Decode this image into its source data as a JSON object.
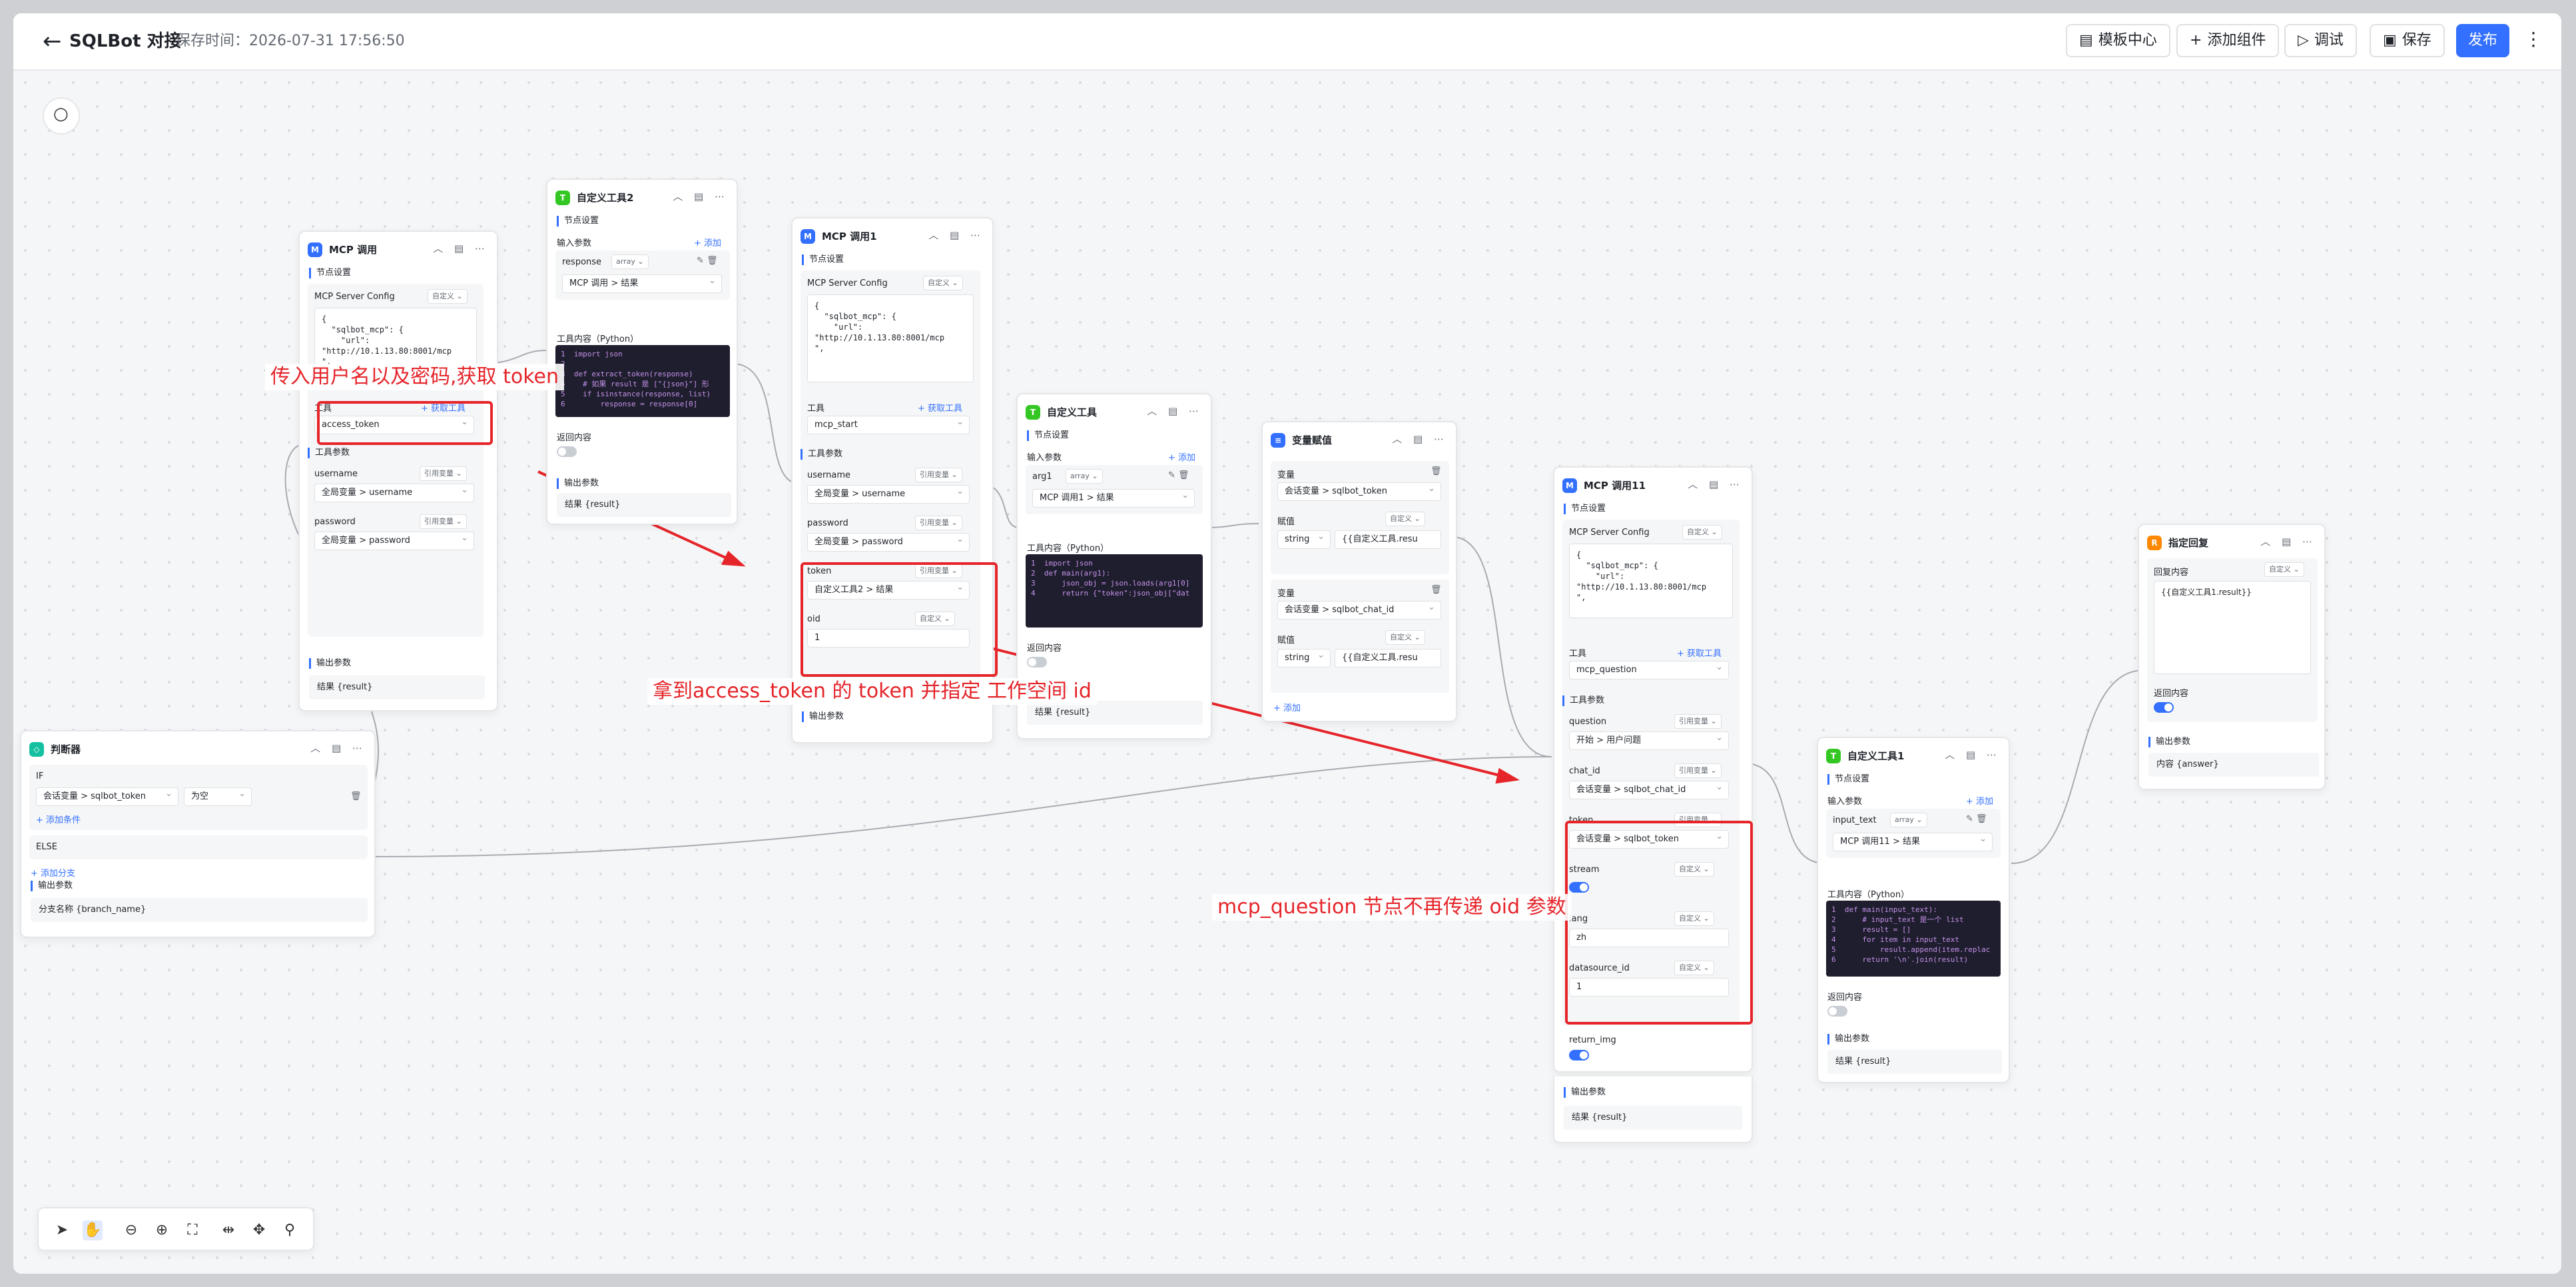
{
  "header": {
    "back": "←",
    "title": "SQLBot 对接",
    "save_time": "保存时间：2026-07-31 17:56:50",
    "template_center": "模板中心",
    "add_component": "添加组件",
    "debug": "调试",
    "save": "保存",
    "publish": "发布",
    "more": "⋮"
  },
  "icons": {
    "back": "arrow-left-icon",
    "search": "search-icon",
    "template": "file-icon",
    "add": "plus-icon",
    "debug": "play-icon",
    "save": "save-icon"
  },
  "colors": {
    "accent": "#3370ff",
    "annotation": "#e5252a",
    "node_mcp": "#3370ff",
    "node_tool": "#34c724",
    "node_reply": "#ff8800"
  },
  "common": {
    "node_settings": "节点设置",
    "input_params": "输入参数",
    "tool_params": "工具参数",
    "output_params": "输出参数",
    "tool_content": "工具内容（Python）",
    "return_content": "返回内容",
    "add": "+ 添加",
    "get_tools": "+ 获取工具",
    "tool": "工具",
    "mcp_server_config": "MCP Server Config",
    "custom": "自定义",
    "ref_var": "引用变量",
    "result": "结果 {result}",
    "array": "array"
  },
  "mcp1": {
    "title": "MCP 调用",
    "config": "{\n  \"sqlbot_mcp\": {\n    \"url\":\n\"http://10.1.13.80:8001/mcp\n\",",
    "tool": "access_token",
    "p1": "username",
    "p1v": "全局变量 > username",
    "p2": "password",
    "p2v": "全局变量 > password"
  },
  "tool2": {
    "title": "自定义工具2",
    "param": "response",
    "paramv": "MCP 调用 > 结果",
    "code": "1  import json\n2\n3  def extract_token(response)\n4    # 如果 result 是 [\"{json}\"] 形\n5    if isinstance(response, list)\n6        response = response[0]"
  },
  "mcp2": {
    "title": "MCP 调用1",
    "config": "{\n  \"sqlbot_mcp\": {\n    \"url\":\n\"http://10.1.13.80:8001/mcp\n\",",
    "tool": "mcp_start",
    "p1": "username",
    "p1v": "全局变量 > username",
    "p2": "password",
    "p2v": "全局变量 > password",
    "p3": "token",
    "p3v": "自定义工具2 > 结果",
    "p4": "oid",
    "p4v": "1"
  },
  "tool1": {
    "title": "自定义工具",
    "param": "arg1",
    "paramv": "MCP 调用1 > 结果",
    "code": "1  import json\n2  def main(arg1):\n3      json_obj = json.loads(arg1[0]\n4      return {\"token\":json_obj[\"dat"
  },
  "assign": {
    "title": "变量赋值",
    "var": "变量",
    "val": "赋值",
    "v1": "会话变量 > sqlbot_token",
    "t1": "string",
    "e1": "{{自定义工具.resu",
    "v2": "会话变量 > sqlbot_chat_id",
    "t2": "string",
    "e2": "{{自定义工具.resu"
  },
  "mcp3": {
    "title": "MCP 调用11",
    "config": "{\n  \"sqlbot_mcp\": {\n    \"url\":\n\"http://10.1.13.80:8001/mcp\n\",",
    "tool": "mcp_question",
    "q": "question",
    "qv": "开始 > 用户问题",
    "c": "chat_id",
    "cv": "会话变量 > sqlbot_chat_id",
    "t": "token",
    "tv": "会话变量 > sqlbot_token",
    "s": "stream",
    "l": "lang",
    "lv": "zh",
    "d": "datasource_id",
    "dv": "1",
    "r": "return_img"
  },
  "tool11": {
    "title": "自定义工具1",
    "param": "input_text",
    "paramv": "MCP 调用11 > 结果",
    "code": "1  def main(input_text):\n2      # input_text 是一个 list\n3      result = []\n4      for item in input_text\n5          result.append(item.replac\n6      return '\\n'.join(result)"
  },
  "reply": {
    "title": "指定回复",
    "content_label": "回复内容",
    "content": "{{自定义工具1.result}}",
    "out": "内容 {answer}"
  },
  "cond": {
    "title": "判断器",
    "if": "IF",
    "left": "会话变量 > sqlbot_token",
    "op": "为空",
    "add_cond": "+ 添加条件",
    "else": "ELSE",
    "add_branch": "+ 添加分支",
    "out": "分支名称 {branch_name}"
  },
  "annotations": {
    "a1": "传入用户名以及密码,获取 token",
    "a2": "拿到access_token 的 token 并指定 工作空间 id",
    "a3": "mcp_question 节点不再传递 oid 参数"
  }
}
